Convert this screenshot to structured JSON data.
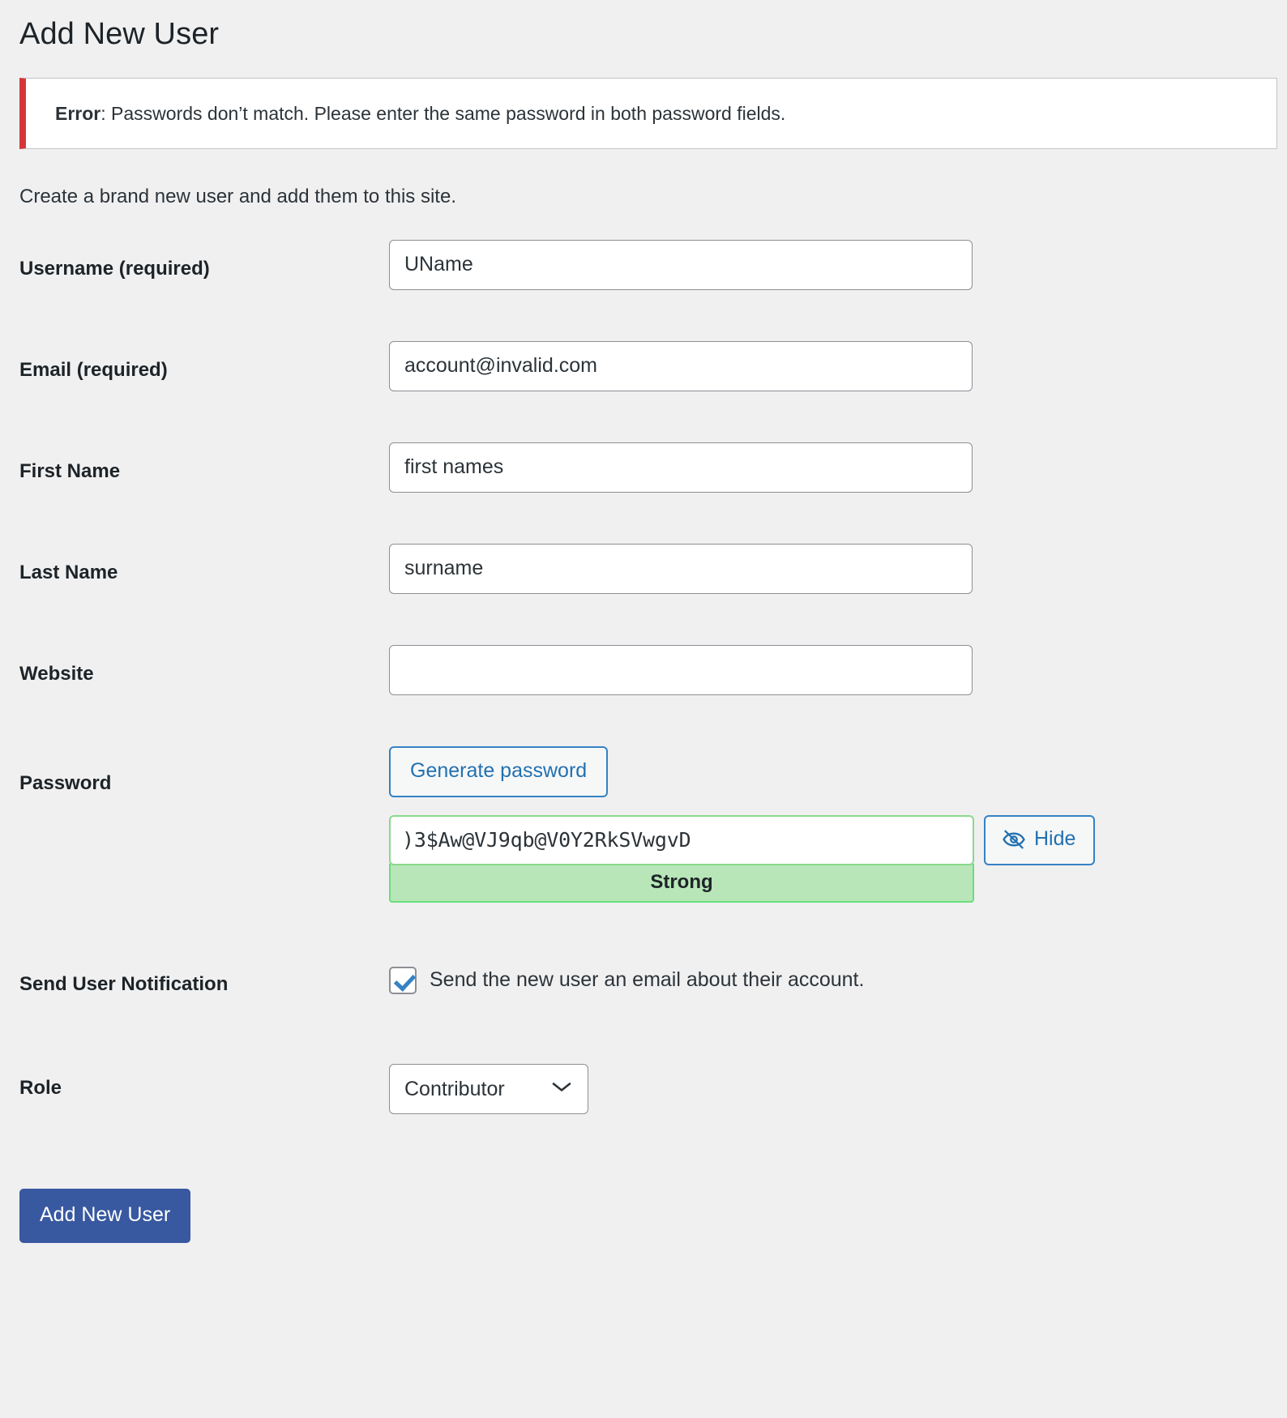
{
  "page": {
    "title": "Add New User",
    "intro": "Create a brand new user and add them to this site."
  },
  "notice": {
    "prefix": "Error",
    "separator": ":",
    "message": " Passwords don’t match. Please enter the same password in both password fields.",
    "accent_color": "#d63638"
  },
  "form": {
    "username": {
      "label": "Username (required)",
      "value": "UName",
      "placeholder": ""
    },
    "email": {
      "label": "Email (required)",
      "value": "account@invalid.com",
      "placeholder": ""
    },
    "first_name": {
      "label": "First Name",
      "value": "first names",
      "placeholder": ""
    },
    "last_name": {
      "label": "Last Name",
      "value": "surname",
      "placeholder": ""
    },
    "website": {
      "label": "Website",
      "value": "",
      "placeholder": ""
    },
    "password": {
      "label": "Password",
      "generate_label": "Generate password",
      "value": ")3$Aw@VJ9qb@V0Y2RkSVwgvD",
      "hide_label": "Hide",
      "hide_icon": "eye-slash-icon",
      "strength_label": "Strong",
      "strength_color": "#b8e6b8",
      "strength_border": "#68de7c"
    },
    "notification": {
      "label": "Send User Notification",
      "checkbox_label": "Send the new user an email about their account.",
      "checked": true
    },
    "role": {
      "label": "Role",
      "value": "Contributor",
      "options": [
        "Contributor"
      ],
      "chevron_icon": "chevron-down-icon"
    }
  },
  "submit": {
    "label": "Add New User",
    "color": "#3858a0"
  }
}
